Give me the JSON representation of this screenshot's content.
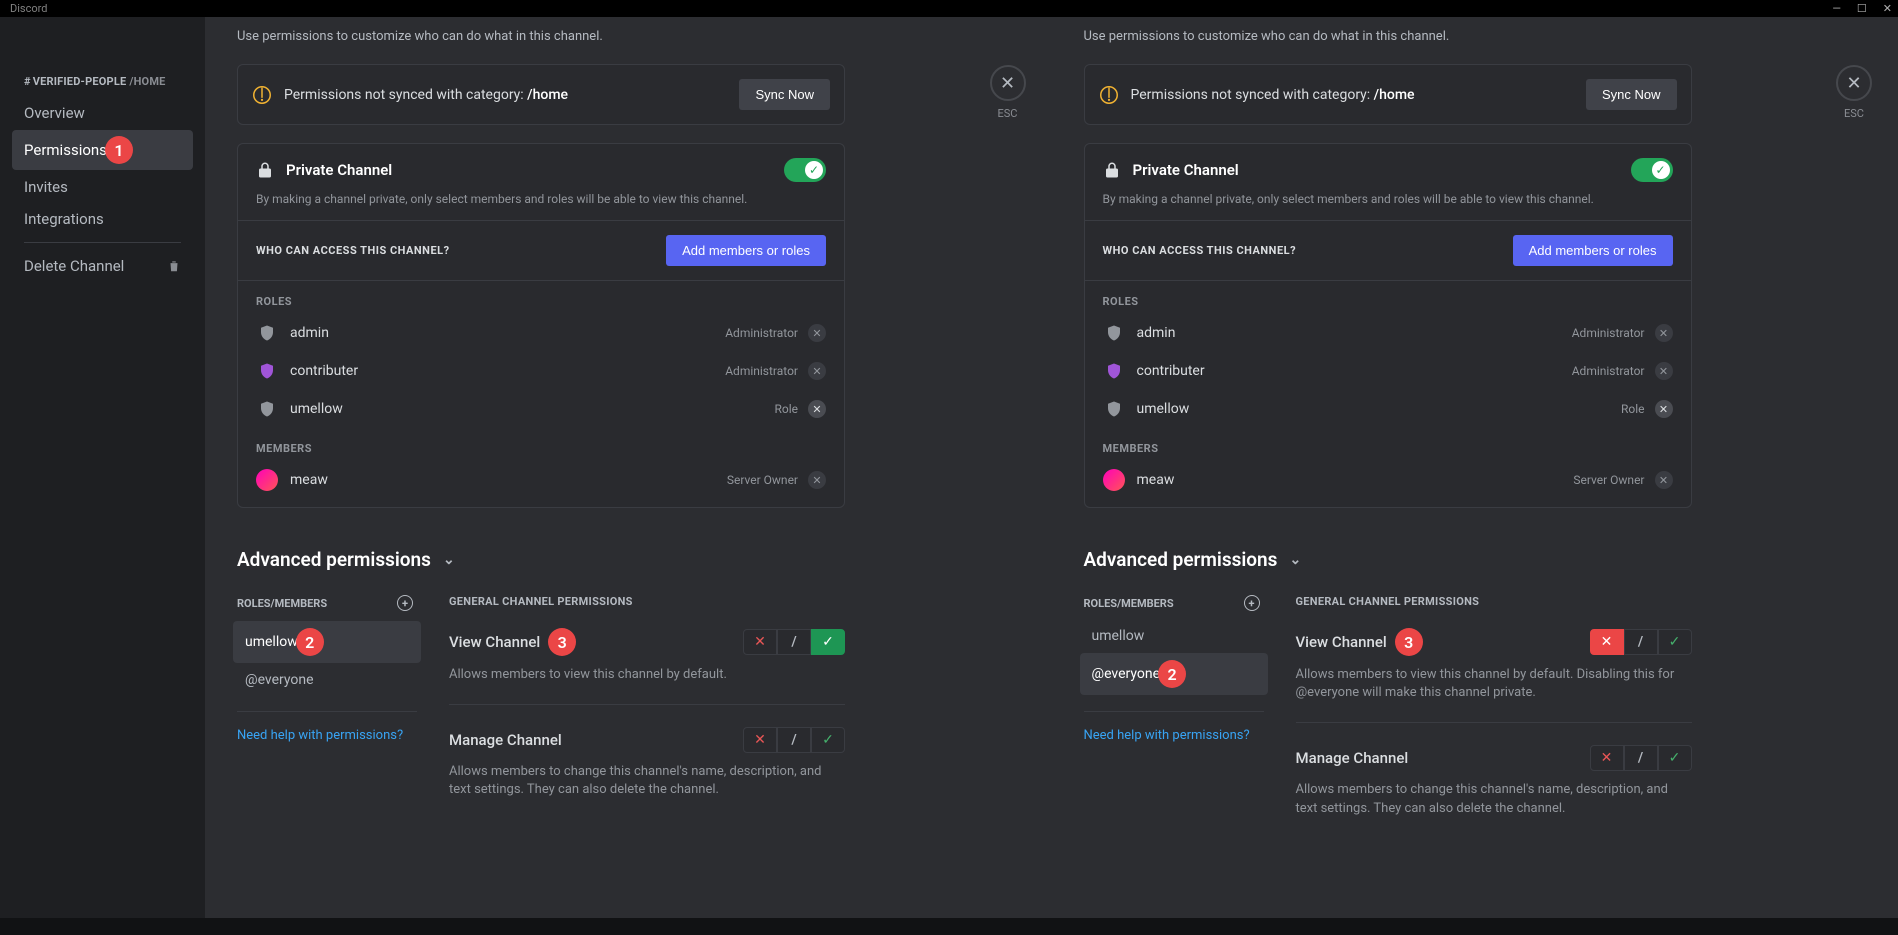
{
  "titlebar": {
    "app": "Discord"
  },
  "sidebar": {
    "header_prefix": "VERIFIED-PEOPLE",
    "header_suffix": "/HOME",
    "items": [
      {
        "label": "Overview"
      },
      {
        "label": "Permissions",
        "badge": "1"
      },
      {
        "label": "Invites"
      },
      {
        "label": "Integrations"
      }
    ],
    "delete": "Delete Channel"
  },
  "esc": "ESC",
  "panel": {
    "intro": "Use permissions to customize who can do what in this channel.",
    "sync_text": "Permissions not synced with category: ",
    "sync_path": "/home",
    "sync_btn": "Sync Now",
    "private_title": "Private Channel",
    "private_sub": "By making a channel private, only select members and roles will be able to view this channel.",
    "who_label": "WHO CAN ACCESS THIS CHANNEL?",
    "add_btn": "Add members or roles",
    "roles_label": "ROLES",
    "roles": [
      {
        "name": "admin",
        "tag": "Administrator",
        "removable": false
      },
      {
        "name": "contributer",
        "tag": "Administrator",
        "removable": false
      },
      {
        "name": "umellow",
        "tag": "Role",
        "removable": true
      }
    ],
    "members_label": "MEMBERS",
    "member": {
      "name": "meaw",
      "tag": "Server Owner"
    }
  },
  "adv": {
    "heading": "Advanced permissions",
    "rm_label": "ROLES/MEMBERS",
    "help": "Need help with permissions?",
    "gcp": "GENERAL CHANNEL PERMISSIONS",
    "badge2": "2",
    "badge3": "3"
  },
  "left": {
    "rm": [
      "umellow",
      "@everyone"
    ],
    "perms": [
      {
        "title": "View Channel",
        "desc": "Allows members to view this channel by default.",
        "state": "allow",
        "badge": true
      },
      {
        "title": "Manage Channel",
        "desc": "Allows members to change this channel's name, description, and text settings. They can also delete the channel.",
        "state": "neutral"
      }
    ]
  },
  "right": {
    "rm": [
      "umellow",
      "@everyone"
    ],
    "perms": [
      {
        "title": "View Channel",
        "desc": "Allows members to view this channel by default. Disabling this for @everyone will make this channel private.",
        "state": "deny",
        "badge": true
      },
      {
        "title": "Manage Channel",
        "desc": "Allows members to change this channel's name, description, and text settings. They can also delete the channel.",
        "state": "neutral"
      }
    ]
  }
}
